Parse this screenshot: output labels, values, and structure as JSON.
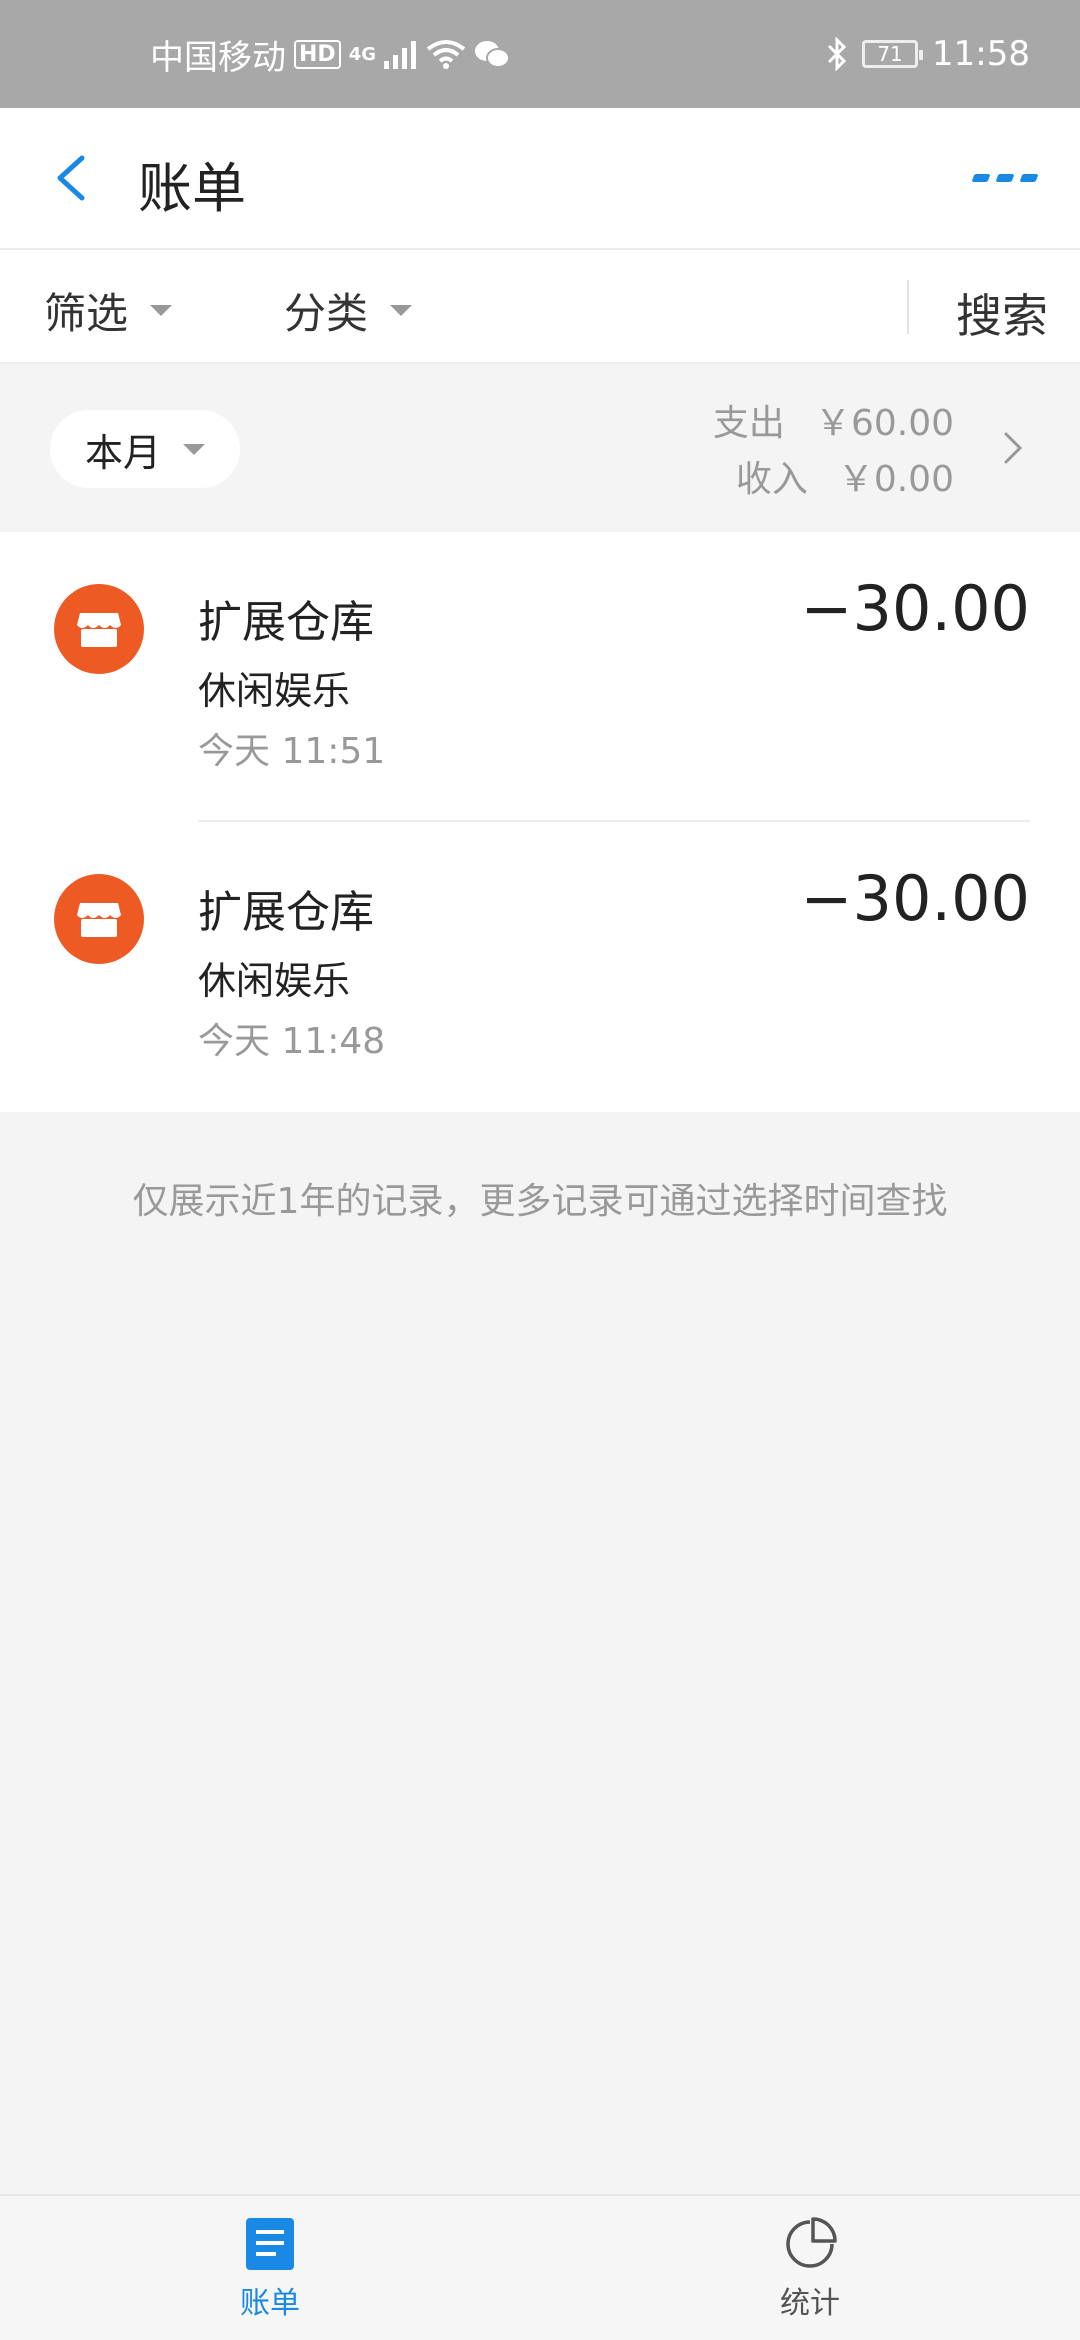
{
  "status_bar": {
    "carrier": "中国移动",
    "hd": "HD",
    "network": "4G",
    "battery": "71",
    "time": "11:58"
  },
  "header": {
    "title": "账单"
  },
  "filters": {
    "filter_label": "筛选",
    "category_label": "分类",
    "search_label": "搜索"
  },
  "summary": {
    "period_label": "本月",
    "expense_label": "支出",
    "expense_value": "￥60.00",
    "income_label": "收入",
    "income_value": "￥0.00"
  },
  "transactions": [
    {
      "title": "扩展仓库",
      "category": "休闲娱乐",
      "time": "今天  11:51",
      "amount": "−30.00"
    },
    {
      "title": "扩展仓库",
      "category": "休闲娱乐",
      "time": "今天  11:48",
      "amount": "−30.00"
    }
  ],
  "notice": "仅展示近1年的记录，更多记录可通过选择时间查找",
  "tabs": [
    {
      "label": "账单",
      "icon": "bill-icon",
      "active": true
    },
    {
      "label": "统计",
      "icon": "pie-chart-icon",
      "active": false
    }
  ],
  "colors": {
    "accent": "#1a89e6",
    "merchant_icon": "#ee5a24",
    "status_bar": "#a8a8a8"
  }
}
